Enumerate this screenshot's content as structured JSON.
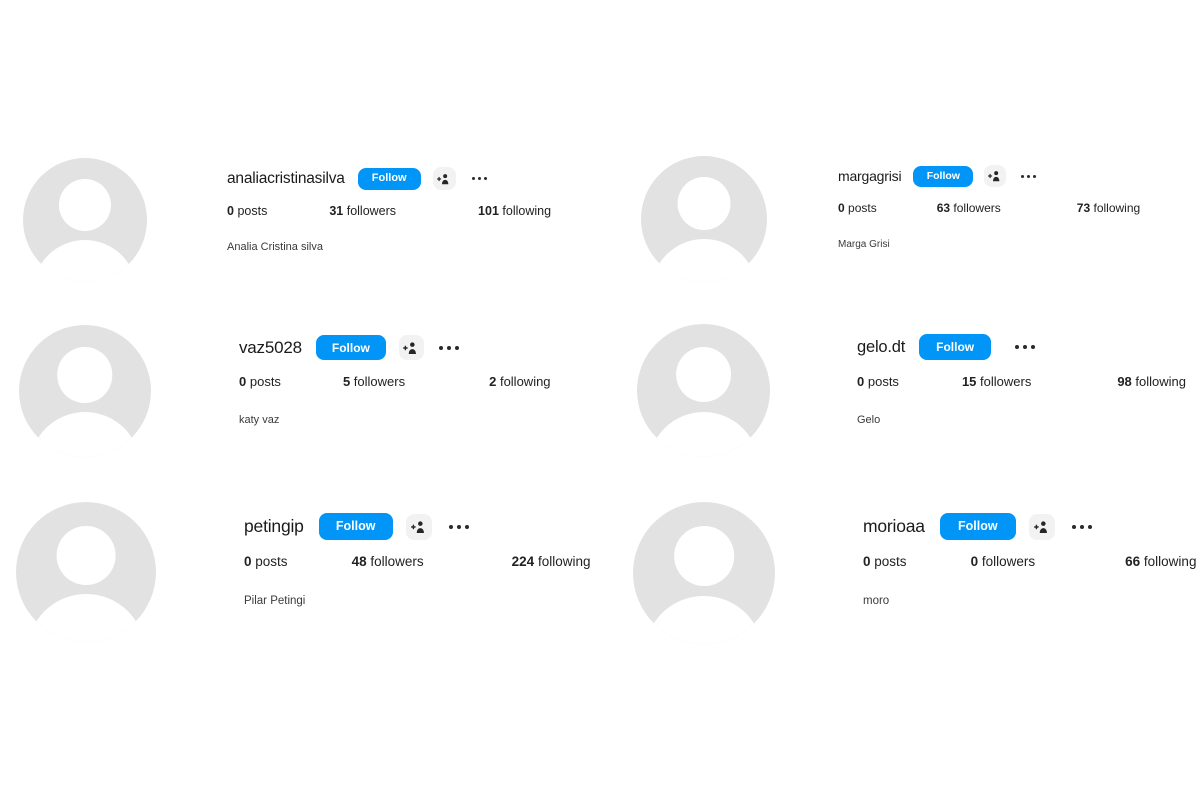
{
  "page": {
    "title": "Instagram suggested profiles list",
    "background_color": "#ffffff",
    "accent_color": "#0095f6",
    "avatar_color": "#e2e2e2",
    "icon_button_background": "#f2f2f2"
  },
  "labels": {
    "follow": "Follow",
    "posts_word": "posts",
    "followers_word": "followers",
    "following_word": "following",
    "person_add_icon": "person-add-icon",
    "more_icon": "more-horizontal-icon",
    "avatar_icon": "default-avatar-icon"
  },
  "profiles": [
    {
      "username": "analiacristinasilva",
      "follow_label": "Follow",
      "posts": "0",
      "posts_label": "posts",
      "followers": "31",
      "followers_label": "followers",
      "following": "101",
      "following_label": "following",
      "fullname": "Analia Cristina silva",
      "has_person_add": true,
      "has_more": true
    },
    {
      "username": "margagrisi",
      "follow_label": "Follow",
      "posts": "0",
      "posts_label": "posts",
      "followers": "63",
      "followers_label": "followers",
      "following": "73",
      "following_label": "following",
      "fullname": "Marga Grisi",
      "has_person_add": true,
      "has_more": true
    },
    {
      "username": "vaz5028",
      "follow_label": "Follow",
      "posts": "0",
      "posts_label": "posts",
      "followers": "5",
      "followers_label": "followers",
      "following": "2",
      "following_label": "following",
      "fullname": "katy vaz",
      "has_person_add": true,
      "has_more": true
    },
    {
      "username": "gelo.dt",
      "follow_label": "Follow",
      "posts": "0",
      "posts_label": "posts",
      "followers": "15",
      "followers_label": "followers",
      "following": "98",
      "following_label": "following",
      "fullname": "Gelo",
      "has_person_add": false,
      "has_more": true
    },
    {
      "username": "petingip",
      "follow_label": "Follow",
      "posts": "0",
      "posts_label": "posts",
      "followers": "48",
      "followers_label": "followers",
      "following": "224",
      "following_label": "following",
      "fullname": "Pilar Petingi",
      "has_person_add": true,
      "has_more": true
    },
    {
      "username": "morioaa",
      "follow_label": "Follow",
      "posts": "0",
      "posts_label": "posts",
      "followers": "0",
      "followers_label": "followers",
      "following": "66",
      "following_label": "following",
      "fullname": "moro",
      "has_person_add": true,
      "has_more": true
    }
  ]
}
